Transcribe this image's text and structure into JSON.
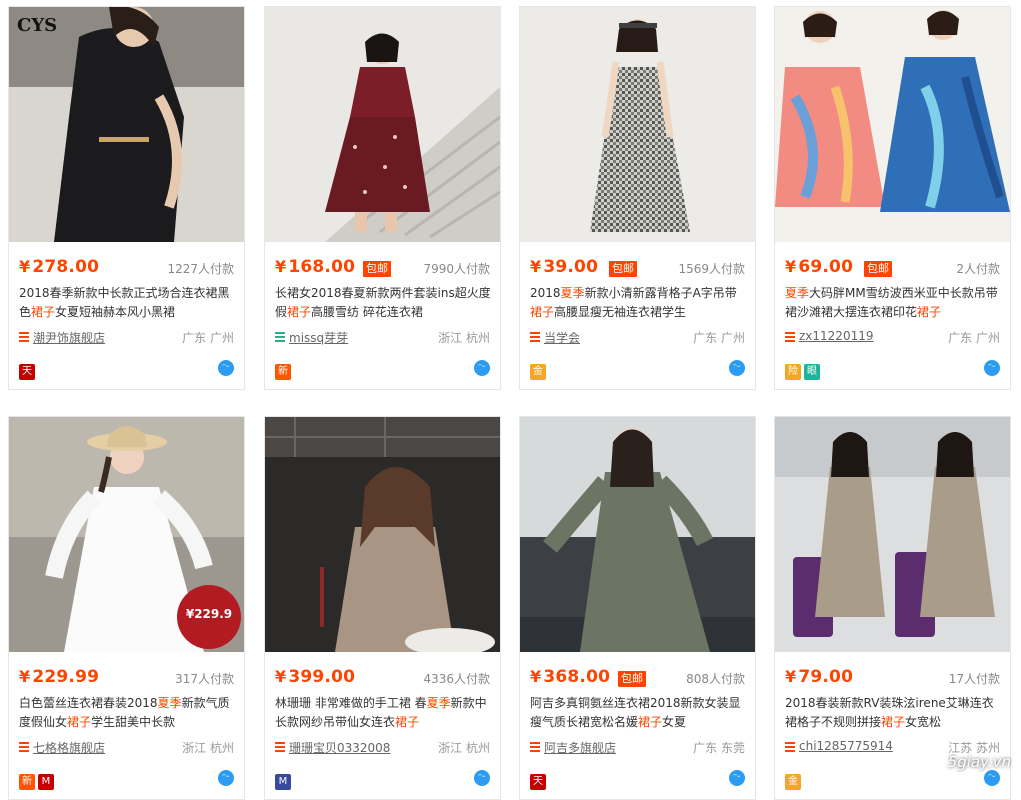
{
  "products": [
    {
      "price": "278.00",
      "baoyou": false,
      "paid": "1227人付款",
      "title_parts": [
        {
          "t": "2018春季新款中长款正式场合连衣裙黑色"
        },
        {
          "t": "裙子",
          "hl": true
        },
        {
          "t": "女夏短袖赫本风小黑裙"
        }
      ],
      "shop": "潮尹饰旗舰店",
      "location": "广东 广州",
      "badges": [
        {
          "label": "天",
          "color": "#c40000"
        }
      ],
      "image_text": "CYS",
      "image_sticker": ""
    },
    {
      "price": "168.00",
      "baoyou": true,
      "paid": "7990人付款",
      "title_parts": [
        {
          "t": "长裙女2018春夏新款两件套装ins超火度假"
        },
        {
          "t": "裙子",
          "hl": true
        },
        {
          "t": "高腰雪纺 碎花连衣裙"
        }
      ],
      "shop": "missq芽芽",
      "location": "浙江 杭州",
      "badges": [
        {
          "label": "新",
          "color": "#ff5500"
        }
      ],
      "image_text": "",
      "image_sticker": ""
    },
    {
      "price": "39.00",
      "baoyou": true,
      "paid": "1569人付款",
      "title_parts": [
        {
          "t": "2018"
        },
        {
          "t": "夏季",
          "hl": true
        },
        {
          "t": "新款小清新露背格子A字吊带"
        },
        {
          "t": "裙子",
          "hl": true
        },
        {
          "t": "高腰显瘦无袖连衣裙学生"
        }
      ],
      "shop": "当学会",
      "location": "广东 广州",
      "badges": [
        {
          "label": "金",
          "color": "#f5a623"
        }
      ],
      "image_text": "",
      "image_sticker": ""
    },
    {
      "price": "69.00",
      "baoyou": true,
      "paid": "2人付款",
      "title_parts": [
        {
          "t": "夏季",
          "hl": true
        },
        {
          "t": "大码胖MM雪纺波西米亚中长款吊带裙沙滩裙大摆连衣裙印花"
        },
        {
          "t": "裙子",
          "hl": true
        }
      ],
      "shop": "zx11220119",
      "location": "广东 广州",
      "badges": [
        {
          "label": "眼",
          "color": "#1fb39b"
        },
        {
          "label": "险",
          "color": "#f5a623"
        }
      ],
      "image_text": "",
      "image_sticker": ""
    },
    {
      "price": "229.99",
      "baoyou": false,
      "paid": "317人付款",
      "title_parts": [
        {
          "t": "白色蕾丝连衣裙春装2018"
        },
        {
          "t": "夏季",
          "hl": true
        },
        {
          "t": "新款气质度假仙女"
        },
        {
          "t": "裙子",
          "hl": true
        },
        {
          "t": "学生甜美中长款"
        }
      ],
      "shop": "七格格旗舰店",
      "location": "浙江 杭州",
      "badges": [
        {
          "label": "M",
          "color": "#c40000"
        },
        {
          "label": "新",
          "color": "#ff5500"
        }
      ],
      "image_text": "",
      "image_sticker": "¥229.9"
    },
    {
      "price": "399.00",
      "baoyou": false,
      "paid": "4336人付款",
      "title_parts": [
        {
          "t": "林珊珊 非常难做的手工裙 春"
        },
        {
          "t": "夏季",
          "hl": true
        },
        {
          "t": "新款中长款网纱吊带仙女连衣"
        },
        {
          "t": "裙子",
          "hl": true
        }
      ],
      "shop": "珊珊宝贝0332008",
      "location": "浙江 杭州",
      "badges": [
        {
          "label": "M",
          "color": "#3a4a9a"
        }
      ],
      "image_text": "",
      "image_sticker": ""
    },
    {
      "price": "368.00",
      "baoyou": true,
      "paid": "808人付款",
      "title_parts": [
        {
          "t": "阿吉多真铜氨丝连衣裙2018新款女装显瘦气质长裙宽松名媛"
        },
        {
          "t": "裙子",
          "hl": true
        },
        {
          "t": "女夏"
        }
      ],
      "shop": "阿吉多旗舰店",
      "location": "广东 东莞",
      "badges": [
        {
          "label": "天",
          "color": "#c40000"
        }
      ],
      "image_text": "",
      "image_sticker": ""
    },
    {
      "price": "79.00",
      "baoyou": false,
      "paid": "17人付款",
      "title_parts": [
        {
          "t": "2018春装新款RV装珠泫irene艾琳连衣裙格子不规则拼接"
        },
        {
          "t": "裙子",
          "hl": true
        },
        {
          "t": "女宽松"
        }
      ],
      "shop": "chi1285775914",
      "location": "江苏 苏州",
      "badges": [
        {
          "label": "金",
          "color": "#f5a623"
        }
      ],
      "image_text": "",
      "image_sticker": ""
    }
  ],
  "labels": {
    "yen": "¥",
    "baoyou": "包邮",
    "ww": "ᵔᵕ"
  },
  "watermark": "5giay.vn"
}
